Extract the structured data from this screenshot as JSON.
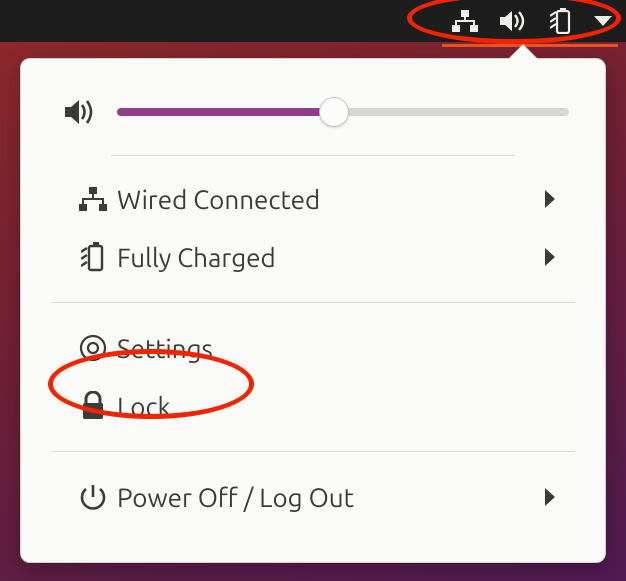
{
  "tray": {
    "icons": [
      "network-wired",
      "volume",
      "battery-charging"
    ],
    "underline_color": "#e95420"
  },
  "volume": {
    "percent": 48
  },
  "menu": {
    "network": {
      "label": "Wired Connected",
      "has_submenu": true
    },
    "battery": {
      "label": "Fully Charged",
      "has_submenu": true
    },
    "settings": {
      "label": "Settings",
      "has_submenu": false
    },
    "lock": {
      "label": "Lock",
      "has_submenu": false
    },
    "power": {
      "label": "Power Off / Log Out",
      "has_submenu": true
    }
  },
  "annotations": {
    "tray_highlighted": true,
    "settings_highlighted": true
  }
}
